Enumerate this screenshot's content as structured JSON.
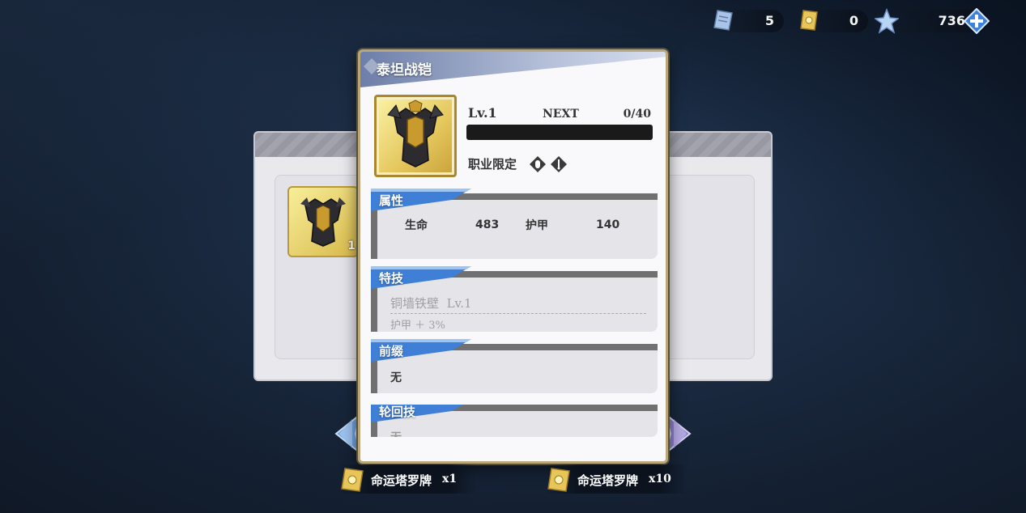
{
  "currencies": [
    {
      "icon": "ticket-icon",
      "value": "5"
    },
    {
      "icon": "tarot-card-icon",
      "value": "0"
    },
    {
      "icon": "star-crystal-icon",
      "value": "736"
    }
  ],
  "item": {
    "name": "泰坦战铠",
    "level": "Lv.1",
    "next_label": "NEXT",
    "exp_text": "0/40",
    "exp_progress": 0,
    "class_label": "职业限定"
  },
  "back_panel": {
    "thumb_count": "1"
  },
  "sections": {
    "attributes": {
      "title": "属性",
      "stats": [
        {
          "label": "生命",
          "value": "483"
        },
        {
          "label": "护甲",
          "value": "140"
        }
      ]
    },
    "skill": {
      "title": "特技",
      "name": "铜墙铁壁",
      "level": "Lv.1",
      "effect": "护甲 ＋ 3%"
    },
    "prefix": {
      "title": "前缀",
      "value": "无"
    },
    "reincarnation": {
      "title": "轮回技",
      "value": "无"
    }
  },
  "draw_buttons": [
    {
      "name": "命运塔罗牌",
      "qty": "x1"
    },
    {
      "name": "命运塔罗牌",
      "qty": "x10"
    }
  ],
  "colors": {
    "accent_blue": "#4f8fe0",
    "gold": "#d8b84a",
    "panel": "#e4e4e9"
  }
}
